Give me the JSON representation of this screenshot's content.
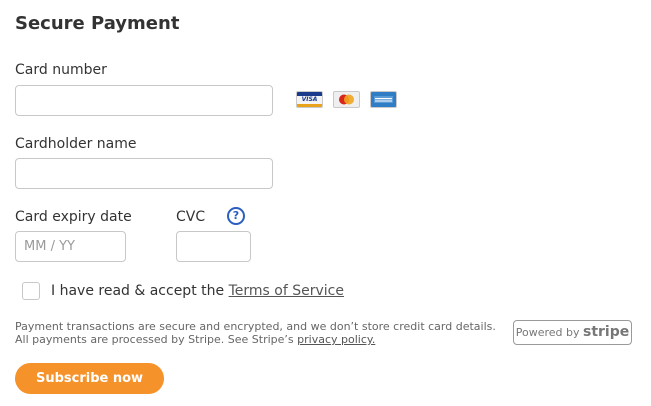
{
  "form": {
    "title": "Secure Payment",
    "card_number": {
      "label": "Card number",
      "value": "",
      "placeholder": ""
    },
    "card_logos": [
      {
        "name": "visa",
        "text": "VISA",
        "color": "#1a3b8c"
      },
      {
        "name": "mastercard",
        "text": "MasterCard",
        "color": "#e8a21c"
      },
      {
        "name": "amex",
        "text": "AMERICAN EXPRESS",
        "color": "#2f7dc4"
      }
    ],
    "cardholder_name": {
      "label": "Cardholder name",
      "value": "",
      "placeholder": ""
    },
    "expiry": {
      "label": "Card expiry date",
      "placeholder": "MM / YY",
      "value": ""
    },
    "cvc": {
      "label": "CVC",
      "value": "",
      "placeholder": "",
      "help_icon": "question-circle-icon",
      "help_glyph": "?"
    },
    "terms": {
      "checked": false,
      "text": "I have read & accept the",
      "link": "Terms of Service"
    },
    "notice": {
      "line1": "Payment transactions are secure and encrypted, and we don’t store credit card details.",
      "line2_prefix": "All payments are processed by Stripe. See Stripe’s",
      "line2_link": "privacy policy."
    },
    "stripe_badge": {
      "prefix": "Powered by",
      "brand": "stripe"
    },
    "submit_label": "Subscribe now"
  },
  "colors": {
    "accent": "#f5922a",
    "help_icon": "#2b5fbf",
    "input_border": "#c8c8c8"
  }
}
